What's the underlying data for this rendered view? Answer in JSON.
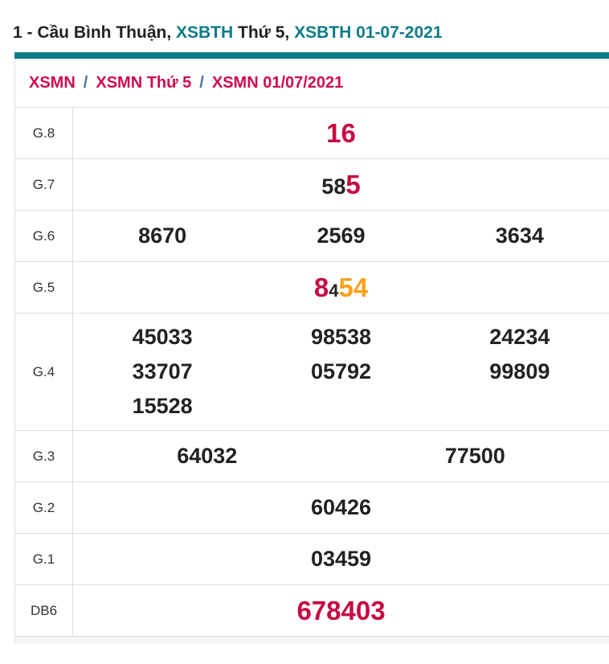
{
  "colors": {
    "teal": "#0e7c88",
    "dark_text": "#222222",
    "number_red": "#c70a42",
    "breadcrumb_red": "#d00c4e",
    "highlight_orange": "#f9a11d",
    "separator_blue": "#46729e",
    "border_gray": "#dedede"
  },
  "header": {
    "title_segments": [
      {
        "text": "1 - Cầu Bình Thuận, ",
        "style": "dark"
      },
      {
        "text": "XSBTH",
        "style": "teal"
      },
      {
        "text": " Thứ 5, ",
        "style": "dark"
      },
      {
        "text": "XSBTH 01-07-2021",
        "style": "teal"
      }
    ]
  },
  "breadcrumb": {
    "separator": "/",
    "items": [
      {
        "label": "XSMN"
      },
      {
        "label": "XSMN Thứ 5"
      },
      {
        "label": "XSMN 01/07/2021"
      }
    ]
  },
  "results_table": {
    "rows": [
      {
        "label": "G.8",
        "layout": "center",
        "cells": [
          [
            {
              "text": "16",
              "style": "red",
              "size": "lg"
            }
          ]
        ]
      },
      {
        "label": "G.7",
        "layout": "center",
        "cells": [
          [
            {
              "text": "58",
              "style": "dark",
              "size": "md"
            },
            {
              "text": "5",
              "style": "red",
              "size": "lg"
            }
          ]
        ]
      },
      {
        "label": "G.6",
        "layout": "cols3",
        "cells": [
          [
            {
              "text": "8670",
              "style": "dark",
              "size": "md"
            }
          ],
          [
            {
              "text": "2569",
              "style": "dark",
              "size": "md"
            }
          ],
          [
            {
              "text": "3634",
              "style": "dark",
              "size": "md"
            }
          ]
        ]
      },
      {
        "label": "G.5",
        "layout": "center",
        "cells": [
          [
            {
              "text": "8",
              "style": "red",
              "size": "lg"
            },
            {
              "text": "4",
              "style": "dark",
              "size": "sm"
            },
            {
              "text": "54",
              "style": "orange",
              "size": "lg"
            }
          ]
        ]
      },
      {
        "label": "G.4",
        "layout": "grid3",
        "cells": [
          [
            {
              "text": "45033",
              "style": "dark",
              "size": "md"
            }
          ],
          [
            {
              "text": "98538",
              "style": "dark",
              "size": "md"
            }
          ],
          [
            {
              "text": "24234",
              "style": "dark",
              "size": "md"
            }
          ],
          [
            {
              "text": "33707",
              "style": "dark",
              "size": "md"
            }
          ],
          [
            {
              "text": "05792",
              "style": "dark",
              "size": "md"
            }
          ],
          [
            {
              "text": "99809",
              "style": "dark",
              "size": "md"
            }
          ],
          [
            {
              "text": "15528",
              "style": "dark",
              "size": "md"
            }
          ]
        ]
      },
      {
        "label": "G.3",
        "layout": "cols2",
        "cells": [
          [
            {
              "text": "64032",
              "style": "dark",
              "size": "md"
            }
          ],
          [
            {
              "text": "77500",
              "style": "dark",
              "size": "md"
            }
          ]
        ]
      },
      {
        "label": "G.2",
        "layout": "center",
        "cells": [
          [
            {
              "text": "60426",
              "style": "dark",
              "size": "md"
            }
          ]
        ]
      },
      {
        "label": "G.1",
        "layout": "center",
        "cells": [
          [
            {
              "text": "03459",
              "style": "dark",
              "size": "md"
            }
          ]
        ]
      },
      {
        "label": "DB6",
        "layout": "center",
        "cells": [
          [
            {
              "text": "678403",
              "style": "red",
              "size": "lg"
            }
          ]
        ]
      }
    ]
  }
}
